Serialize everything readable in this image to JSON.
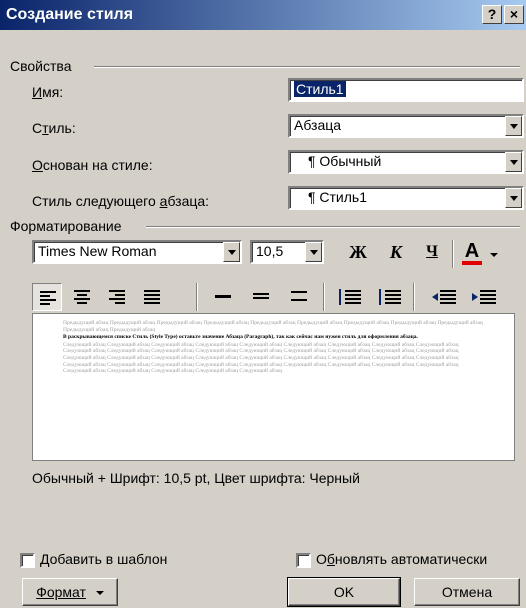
{
  "window": {
    "title": "Создание стиля",
    "help_btn": "?",
    "close_btn": "×"
  },
  "properties": {
    "group_label": "Свойства",
    "name_label": "Имя:",
    "name_value": "Стиль1",
    "style_label": "Стиль:",
    "style_value": "Абзаца",
    "based_label": "Основан на стиле:",
    "based_value": "¶ Обычный",
    "next_label": "Стиль следующего абзаца:",
    "next_value": "¶ Стиль1"
  },
  "formatting": {
    "group_label": "Форматирование",
    "font": "Times New Roman",
    "size": "10,5",
    "bold": "Ж",
    "italic": "К",
    "underline": "Ч",
    "font_color_glyph": "А",
    "font_color": "#e00000",
    "align_selected": "left"
  },
  "preview": {
    "prev_text": "Предыдущий абзац Предыдущий абзац Предыдущий абзац Предыдущий абзац Предыдущий абзац Предыдущий абзац Предыдущий абзац Предыдущий абзац Предыдущий абзац Предыдущий абзац Предыдущий абзац",
    "current_text": "В раскрывающемся списке Стиль (Style Type) оставьте значение Абзаца (Paragraph), так как сейчас нам нужен стиль для оформления абзаца.",
    "next_text": "Следующий абзац Следующий абзац Следующий абзац Следующий абзац Следующий абзац Следующий абзац Следующий абзац Следующий абзац Следующий абзац Следующий абзац Следующий абзац Следующий абзац Следующий абзац Следующий абзац Следующий абзац Следующий абзац Следующий абзац Следующий абзац Следующий абзац Следующий абзац Следующий абзац Следующий абзац Следующий абзац Следующий абзац Следующий абзац Следующий абзац Следующий абзац Следующий абзац Следующий абзац Следующий абзац Следующий абзац Следующий абзац Следующий абзац Следующий абзац Следующий абзац Следующий абзац Следующий абзац Следующий абзац Следующий абзац Следующий абзац Следующий абзац"
  },
  "description": "Обычный + Шрифт: 10,5 pt, Цвет шрифта: Черный",
  "options": {
    "add_to_template": "Добавить в шаблон",
    "auto_update": "Обновлять автоматически",
    "add_checked": false,
    "auto_checked": false
  },
  "buttons": {
    "format": "Формат",
    "ok": "OK",
    "cancel": "Отмена"
  }
}
